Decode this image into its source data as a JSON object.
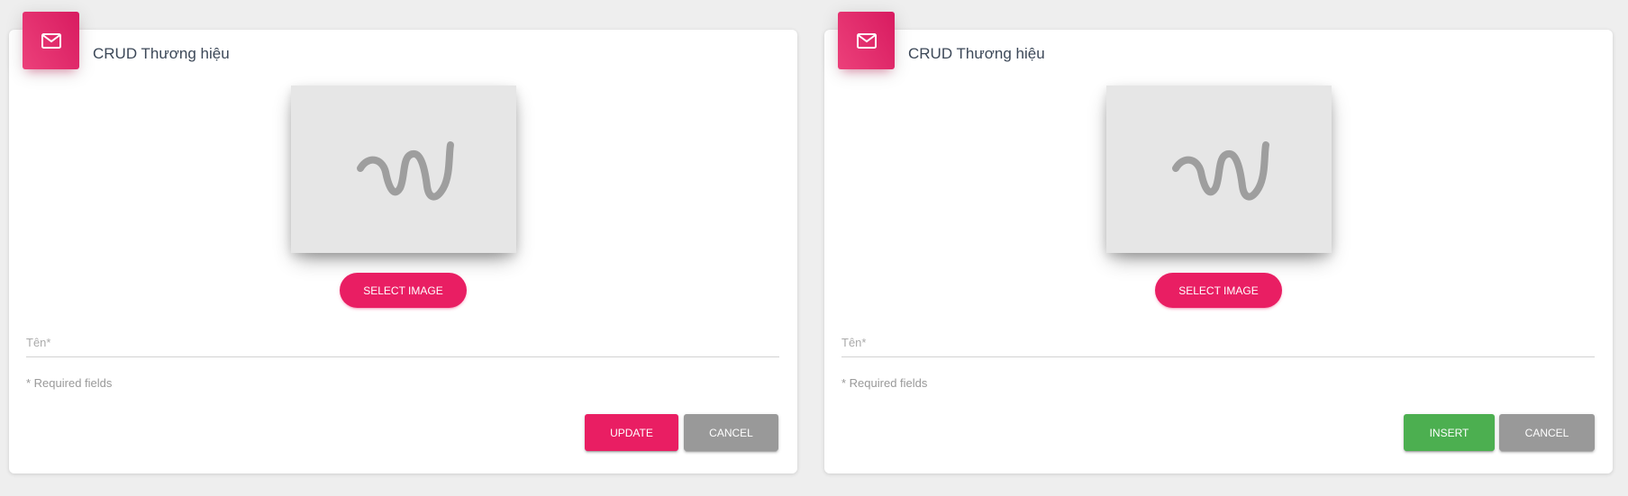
{
  "panels": [
    {
      "title": "CRUD Thương hiệu",
      "select_image_label": "SELECT IMAGE",
      "name_field": {
        "label": "Tên*",
        "value": ""
      },
      "required_note": "* Required fields",
      "primary_button": "UPDATE",
      "cancel_button": "CANCEL"
    },
    {
      "title": "CRUD Thương hiệu",
      "select_image_label": "SELECT IMAGE",
      "name_field": {
        "label": "Tên*",
        "value": ""
      },
      "required_note": "* Required fields",
      "primary_button": "INSERT",
      "cancel_button": "CANCEL"
    }
  ],
  "icons": {
    "header": "mail-icon",
    "image_placeholder": "image-placeholder-icon"
  },
  "colors": {
    "accent": "#e91e63",
    "insert": "#4caf50",
    "cancel": "#999999",
    "background": "#eeeeee"
  }
}
